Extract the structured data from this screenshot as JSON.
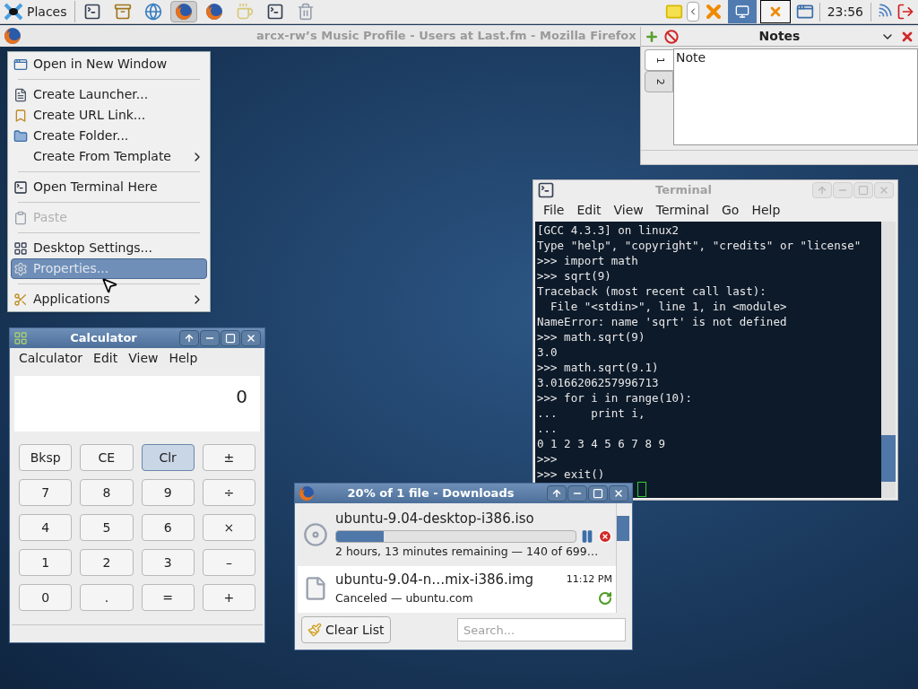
{
  "panel": {
    "places": "Places",
    "launchers": [
      {
        "kind": "terminal",
        "selected": false
      },
      {
        "kind": "cabinet",
        "selected": false
      },
      {
        "kind": "globe",
        "selected": false
      },
      {
        "kind": "firefox",
        "selected": true
      },
      {
        "kind": "firefox",
        "selected": false
      },
      {
        "kind": "teapot",
        "selected": false
      },
      {
        "kind": "terminal",
        "selected": false
      },
      {
        "kind": "trash",
        "selected": false
      }
    ],
    "clock": "23:56"
  },
  "browser": {
    "title": "arcx-rw’s Music Profile - Users at Last.fm - Mozilla Firefox"
  },
  "context_menu": {
    "items": [
      {
        "kind": "window",
        "label": "Open in New Window",
        "selected": false,
        "disabled": false,
        "submenu": false
      },
      {
        "kind": "separator"
      },
      {
        "kind": "launcher",
        "label": "Create Launcher...",
        "selected": false,
        "disabled": false,
        "submenu": false
      },
      {
        "kind": "link",
        "label": "Create URL Link...",
        "selected": false,
        "disabled": false,
        "submenu": false
      },
      {
        "kind": "folder",
        "label": "Create Folder...",
        "selected": false,
        "disabled": false,
        "submenu": false
      },
      {
        "kind": "plain",
        "label": "Create From Template",
        "selected": false,
        "disabled": false,
        "submenu": true
      },
      {
        "kind": "separator"
      },
      {
        "kind": "terminal",
        "label": "Open Terminal Here",
        "selected": false,
        "disabled": false,
        "submenu": false
      },
      {
        "kind": "separator"
      },
      {
        "kind": "paste",
        "label": "Paste",
        "selected": false,
        "disabled": true,
        "submenu": false
      },
      {
        "kind": "separator"
      },
      {
        "kind": "settings",
        "label": "Desktop Settings...",
        "selected": false,
        "disabled": false,
        "submenu": false
      },
      {
        "kind": "properties",
        "label": "Properties...",
        "selected": true,
        "disabled": false,
        "submenu": false
      },
      {
        "kind": "separator"
      },
      {
        "kind": "applications",
        "label": "Applications",
        "selected": false,
        "disabled": false,
        "submenu": true
      }
    ]
  },
  "calculator": {
    "title": "Calculator",
    "menu": [
      "Calculator",
      "Edit",
      "View",
      "Help"
    ],
    "display": "0",
    "keys": [
      {
        "label": "Bksp",
        "selected": false
      },
      {
        "label": "CE",
        "selected": false
      },
      {
        "label": "Clr",
        "selected": true
      },
      {
        "label": "±",
        "selected": false
      },
      {
        "label": "7",
        "selected": false
      },
      {
        "label": "8",
        "selected": false
      },
      {
        "label": "9",
        "selected": false
      },
      {
        "label": "÷",
        "selected": false
      },
      {
        "label": "4",
        "selected": false
      },
      {
        "label": "5",
        "selected": false
      },
      {
        "label": "6",
        "selected": false
      },
      {
        "label": "×",
        "selected": false
      },
      {
        "label": "1",
        "selected": false
      },
      {
        "label": "2",
        "selected": false
      },
      {
        "label": "3",
        "selected": false
      },
      {
        "label": "–",
        "selected": false
      },
      {
        "label": "0",
        "selected": false
      },
      {
        "label": ".",
        "selected": false
      },
      {
        "label": "=",
        "selected": false
      },
      {
        "label": "+",
        "selected": false
      }
    ]
  },
  "terminal": {
    "title": "Terminal",
    "menu": [
      "File",
      "Edit",
      "View",
      "Terminal",
      "Go",
      "Help"
    ],
    "lines": [
      "[GCC 4.3.3] on linux2",
      "Type \"help\", \"copyright\", \"credits\" or \"license\"",
      ">>> import math",
      ">>> sqrt(9)",
      "Traceback (most recent call last):",
      "  File \"<stdin>\", line 1, in <module>",
      "NameError: name 'sqrt' is not defined",
      ">>> math.sqrt(9)",
      "3.0",
      ">>> math.sqrt(9.1)",
      "3.0166206257996713",
      ">>> for i in range(10):",
      "...     print i,",
      "...",
      "0 1 2 3 4 5 6 7 8 9",
      ">>>",
      ">>> exit()"
    ]
  },
  "downloads": {
    "title": "20% of 1 file - Downloads",
    "items": [
      {
        "kind": "active",
        "selected": true,
        "name": "ubuntu-9.04-desktop-i386.iso",
        "level": 0.2,
        "status": "2 hours, 13 minutes remaining — 140 of 699…"
      },
      {
        "kind": "canceled",
        "selected": false,
        "name": "ubuntu-9.04-n…mix-i386.img",
        "time": "11:12 PM",
        "status": "Canceled — ubuntu.com"
      }
    ],
    "clear": "Clear List",
    "search": {
      "placeholder": "Search..."
    }
  },
  "notes": {
    "title": "Notes",
    "tabs": [
      {
        "label": "1",
        "selected": true
      },
      {
        "label": "2",
        "selected": false
      }
    ],
    "text": "Note"
  }
}
